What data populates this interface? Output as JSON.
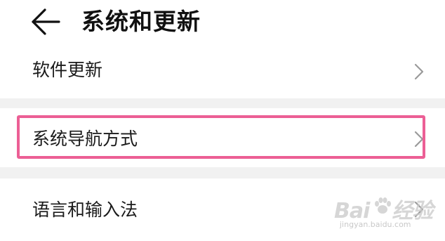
{
  "header": {
    "back_icon": "arrow-left-icon",
    "title": "系统和更新"
  },
  "settings": {
    "items": [
      {
        "label": "软件更新",
        "icon": "chevron-right-icon"
      },
      {
        "label": "系统导航方式",
        "icon": "chevron-right-icon",
        "highlighted": true
      },
      {
        "label": "语言和输入法",
        "icon": "chevron-right-icon"
      }
    ]
  },
  "annotation": {
    "highlight_color": "#ec5f95"
  },
  "colors": {
    "background": "#ffffff",
    "group_gap": "#f1f1f1",
    "text": "#1a1a1a",
    "chevron": "#9a9a9a"
  },
  "watermark": {
    "logo_text": "Bai 经验",
    "url": "jingyan.baidu.com"
  }
}
